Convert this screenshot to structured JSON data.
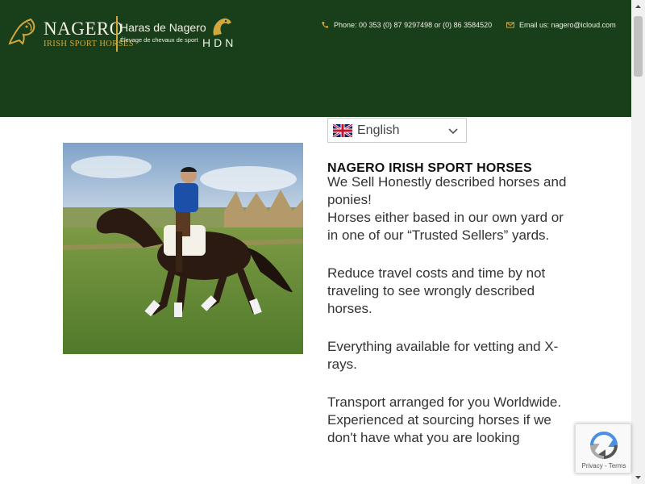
{
  "header": {
    "brand_primary": "NAGERO",
    "brand_primary_sub": "IRISH SPORT HORSES",
    "brand_secondary": "Haras de Nagero",
    "brand_secondary_sub": "Élevage de chevaux de sport",
    "brand_mark": "HDN",
    "phone": "Phone: 00 353 (0) 87 9297498 or (0) 86 3584520",
    "email": "Email us: nagero@icloud.com",
    "icons": {
      "phone": "phone-icon",
      "email": "envelope-icon",
      "logo": "horse-head-logo"
    },
    "colors": {
      "background": "#183f1a",
      "gold": "#d4a73d",
      "cream": "#f3efe4"
    }
  },
  "language": {
    "selected": "English",
    "flag": "uk-flag-icon"
  },
  "main": {
    "photo_alt": "rider-on-bay-horse-photo",
    "heading": "NAGERO IRISH SPORT HORSES",
    "paragraphs": [
      "We Sell Honestly described horses and ponies!",
      "Horses either based in our own yard or in one of our “Trusted Sellers” yards.",
      "Reduce travel costs and time by not traveling to see wrongly described horses.",
      "Everything available for vetting and X-rays.",
      "Transport arranged for you Worldwide.",
      "Experienced at sourcing horses if we don't have what you are looking"
    ]
  },
  "recaptcha": {
    "links": "Privacy - Terms"
  }
}
